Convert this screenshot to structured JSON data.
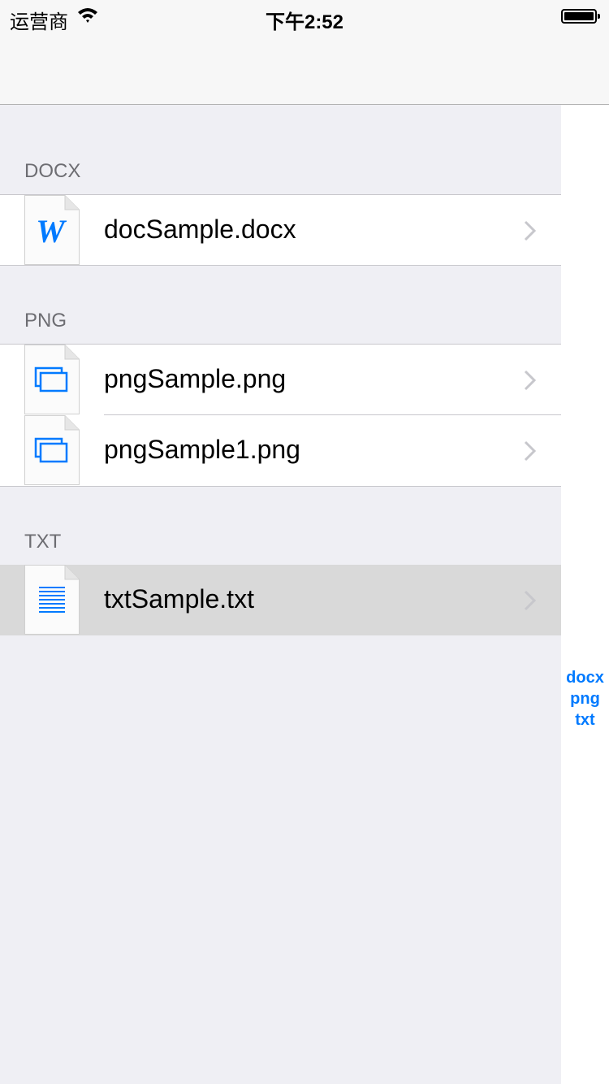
{
  "status_bar": {
    "carrier": "运营商",
    "time": "下午2:52",
    "battery_level": 1.0
  },
  "sections": [
    {
      "title": "DOCX",
      "items": [
        {
          "label": "docSample.docx",
          "icon": "word-doc-icon"
        }
      ]
    },
    {
      "title": "PNG",
      "items": [
        {
          "label": "pngSample.png",
          "icon": "image-doc-icon"
        },
        {
          "label": "pngSample1.png",
          "icon": "image-doc-icon"
        }
      ]
    },
    {
      "title": "TXT",
      "items": [
        {
          "label": "txtSample.txt",
          "icon": "text-doc-icon",
          "highlighted": true
        }
      ]
    }
  ],
  "section_index": [
    "docx",
    "png",
    "txt"
  ],
  "colors": {
    "accent": "#007aff",
    "background": "#efeff4",
    "highlight": "#d9d9d9"
  }
}
